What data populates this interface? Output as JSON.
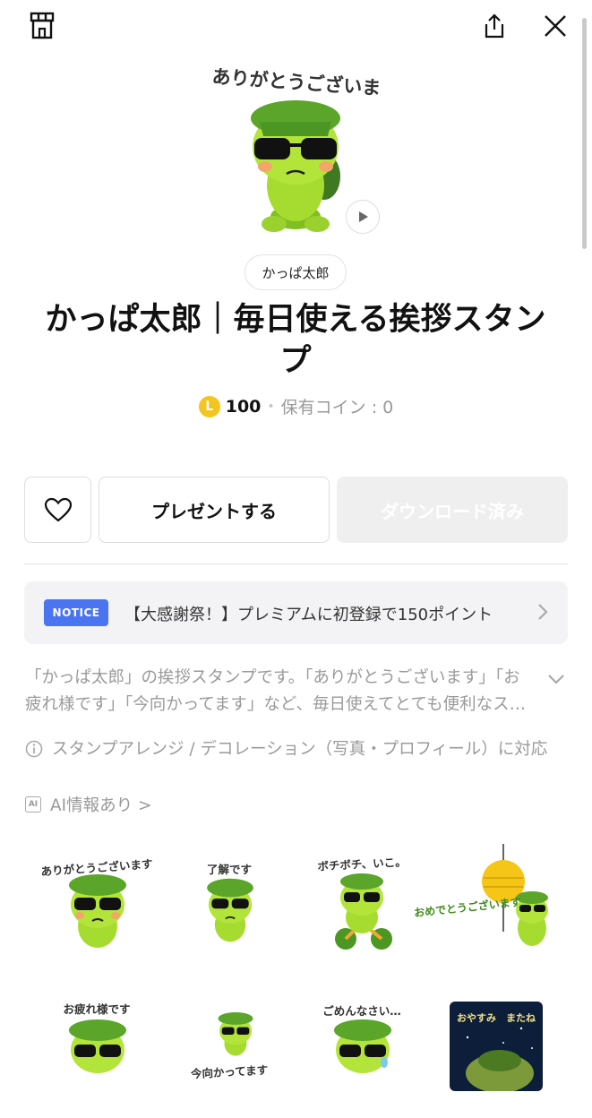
{
  "topbar": {
    "store_icon": "shop-icon",
    "share_icon": "share-icon",
    "close_icon": "close-icon"
  },
  "hero": {
    "caption": "ありがとうございます",
    "play_icon": "play-icon"
  },
  "author": "かっぱ太郎",
  "title": "かっぱ太郎｜毎日使える挨拶スタンプ",
  "price": {
    "coin_letter": "L",
    "amount": "100",
    "separator": "•",
    "owned": "保有コイン : 0"
  },
  "buttons": {
    "favorite_icon": "heart-icon",
    "gift": "プレゼントする",
    "download": "ダウンロード済み"
  },
  "notice": {
    "badge": "NOTICE",
    "text": "【大感謝祭！】プレミアムに初登録で150ポイント",
    "chevron_icon": "chevron-right-icon"
  },
  "description": {
    "text": "「かっぱ太郎」の挨拶スタンプです。「ありがとうございます」「お疲れ様です」「今向かってます」など、毎日使えてとても便利なスタンプです。",
    "chevron_icon": "chevron-down-icon"
  },
  "feature": {
    "icon": "info-icon",
    "text": "スタンプアレンジ / デコレーション（写真・プロフィール）に対応"
  },
  "ai": {
    "icon_label": "AI",
    "text": "AI情報あり >"
  },
  "stickers": [
    {
      "caption": "ありがとうございます"
    },
    {
      "caption": "了解です"
    },
    {
      "caption": "ボチボチ、いこ。"
    },
    {
      "caption": "おめでとうございます"
    },
    {
      "caption": "お疲れ様です"
    },
    {
      "caption": "今向かってます"
    },
    {
      "caption": "ごめんなさい…"
    },
    {
      "caption": "おやすみ　またね"
    }
  ],
  "colors": {
    "accent_blue": "#4b74f0",
    "coin": "#f4c51e",
    "kappa_green": "#9bd12e",
    "hat_green": "#5aa52a"
  }
}
